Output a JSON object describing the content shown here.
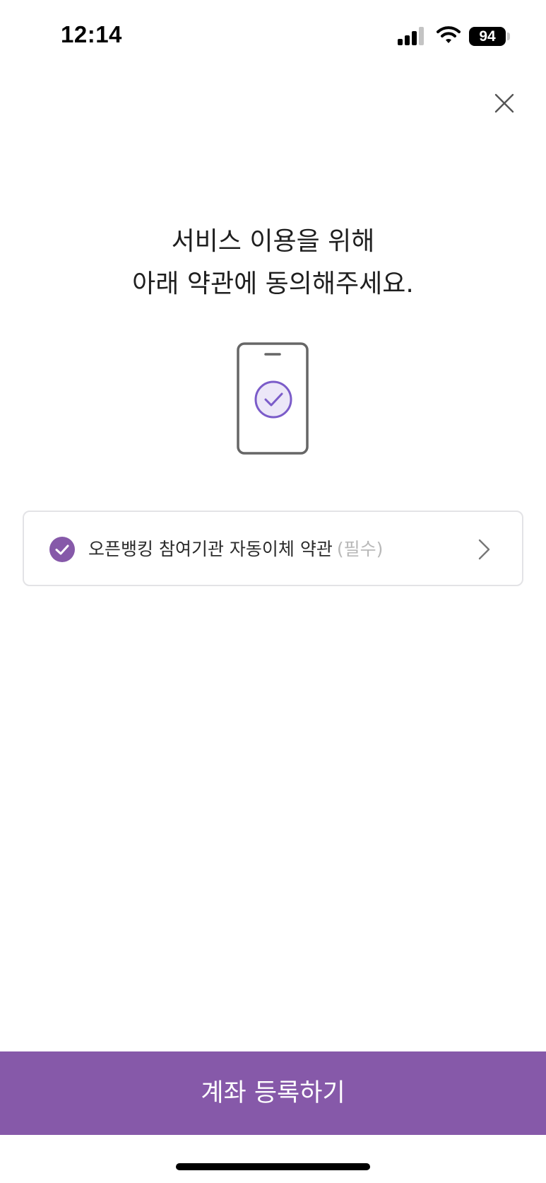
{
  "status_bar": {
    "time": "12:14",
    "battery": "94"
  },
  "header": {
    "close_icon": "close-icon"
  },
  "title": {
    "line1": "서비스 이용을 위해",
    "line2": "아래 약관에 동의해주세요."
  },
  "illustration": {
    "icon": "phone-check-icon",
    "accent_color": "#7b5cc9"
  },
  "terms": [
    {
      "label": "오픈뱅킹 참여기관 자동이체 약관",
      "required": "(필수)",
      "checked": true
    }
  ],
  "footer": {
    "register_label": "계좌 등록하기",
    "button_color": "#8659a9"
  }
}
